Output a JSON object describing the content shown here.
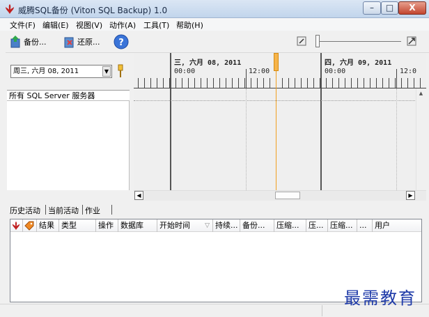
{
  "window": {
    "title": "威腾SQL备份 (Viton SQL Backup) 1.0",
    "close_label": "X",
    "min_label": "–",
    "max_label": "□"
  },
  "menu": [
    "文件(F)",
    "编辑(E)",
    "视图(V)",
    "动作(A)",
    "工具(T)",
    "帮助(H)"
  ],
  "toolbar": {
    "backup_label": "备份...",
    "restore_label": "还原..."
  },
  "left_pane": {
    "date_value": "周三, 六月 08, 2011",
    "server_header": "所有 SQL Server 服务器"
  },
  "timeline": {
    "day1_label": "三, 六月 08, 2011",
    "day2_label": "四, 六月 09, 2011",
    "hour_labels": [
      "00:00",
      "12:00",
      "00:00",
      "12:0"
    ]
  },
  "tabs": [
    "历史活动",
    "当前活动",
    "作业"
  ],
  "grid_columns": [
    "结果",
    "类型",
    "操作",
    "数据库",
    "开始时间",
    "持续...",
    "备份...",
    "压缩...",
    "压...",
    "压缩...",
    "...",
    "用户"
  ],
  "watermark": "最需教育"
}
